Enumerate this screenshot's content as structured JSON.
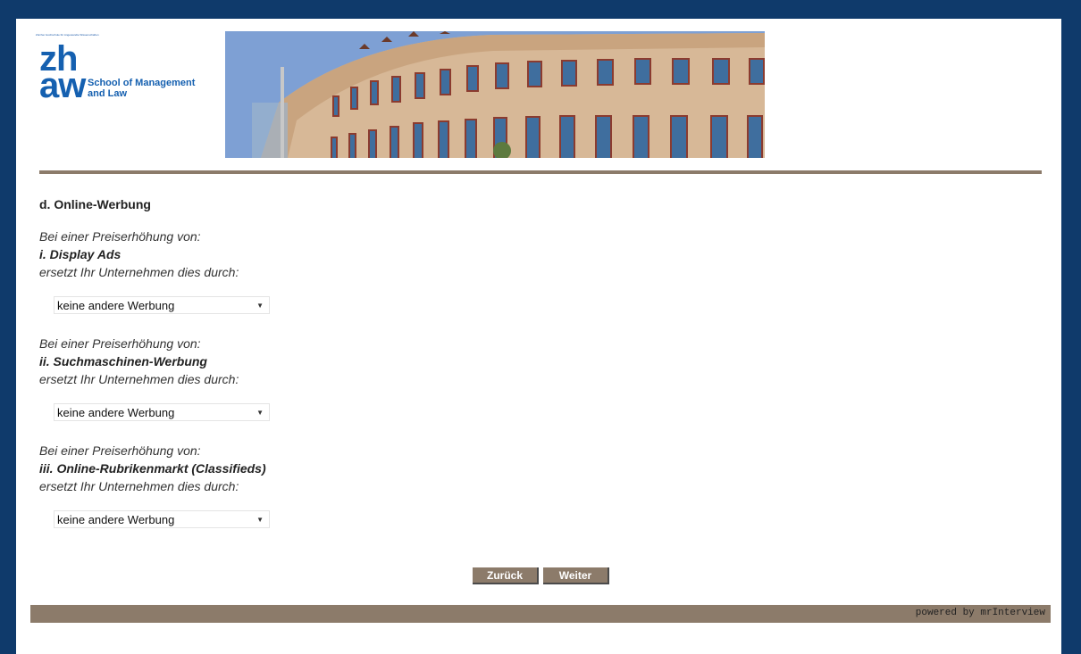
{
  "header": {
    "logo_small_text": "Zürcher Hochschule für Angewandte Wissenschaften",
    "logo_big": "zh aw",
    "school_name": "School of Management and Law"
  },
  "section_title": "d. Online-Werbung",
  "questions": [
    {
      "intro": "Bei einer Preiserhöhung von:",
      "item": "i. Display Ads",
      "suffix": "ersetzt Ihr Unternehmen dies durch:",
      "selected": "keine andere Werbung"
    },
    {
      "intro": "Bei einer Preiserhöhung von:",
      "item": "ii. Suchmaschinen-Werbung",
      "suffix": "ersetzt Ihr Unternehmen dies durch:",
      "selected": "keine andere Werbung"
    },
    {
      "intro": "Bei einer Preiserhöhung von:",
      "item": "iii. Online-Rubrikenmarkt (Classifieds)",
      "suffix": "ersetzt Ihr Unternehmen dies durch:",
      "selected": "keine andere Werbung"
    }
  ],
  "buttons": {
    "back": "Zurück",
    "next": "Weiter"
  },
  "footer": {
    "powered_by": "powered by mrInterview"
  },
  "colors": {
    "frame": "#0f3a6b",
    "accent_brown": "#8c7b6a",
    "logo_blue": "#1560b0"
  }
}
